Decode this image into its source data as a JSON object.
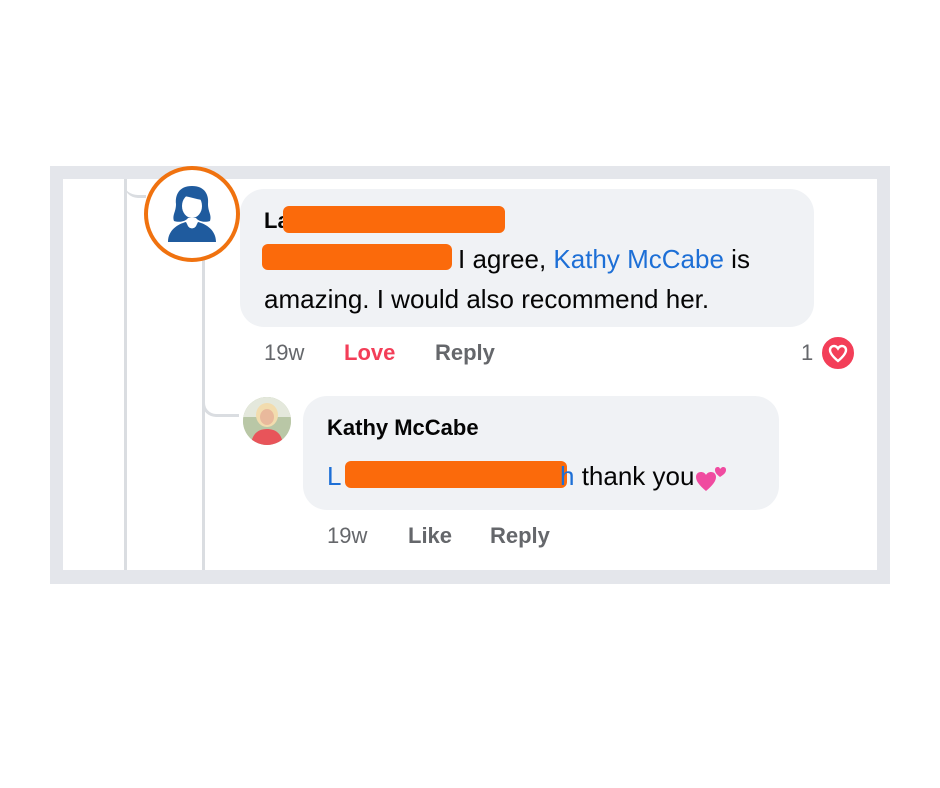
{
  "comment": {
    "author_visible": "La",
    "mention_redacted": "",
    "text_part1": "I agree,",
    "mention_link": "Kathy McCabe",
    "text_part2": "is",
    "text_line2": "amazing. I would also recommend her.",
    "time": "19w",
    "reaction_label": "Love",
    "reply_label": "Reply",
    "reaction_count": "1"
  },
  "reply": {
    "author": "Kathy McCabe",
    "mention_prefix": "L",
    "mention_suffix": "h",
    "text": "thank you",
    "time": "19w",
    "like_label": "Like",
    "reply_label": "Reply"
  },
  "colors": {
    "accent_ring": "#f0720f",
    "redaction": "#fb6a0b",
    "link": "#1d6fd6",
    "love": "#f33e58",
    "bubble": "#f0f2f5"
  },
  "icons": {
    "avatar": "person-silhouette-icon",
    "reaction": "heart-icon",
    "emoji": "two-hearts-emoji"
  }
}
